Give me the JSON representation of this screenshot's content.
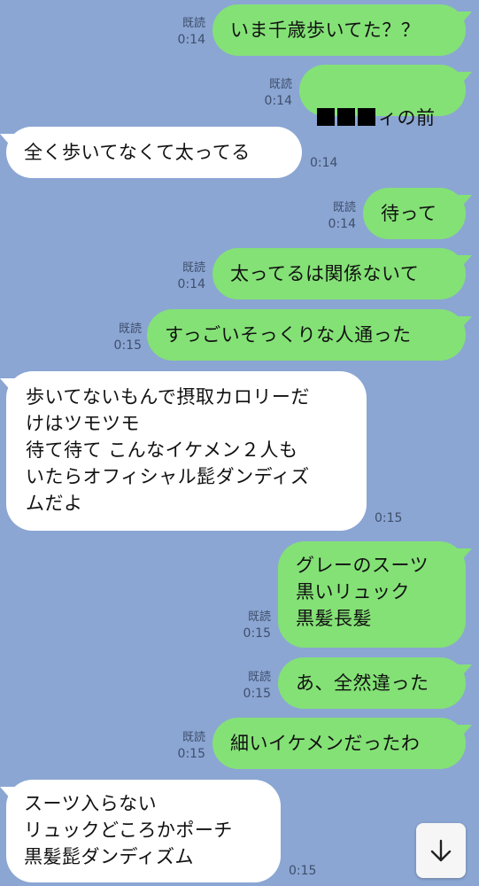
{
  "messages": [
    {
      "direction": "out",
      "text": "いま千歳歩いてた？？",
      "read": "既読",
      "time": "0:14"
    },
    {
      "direction": "out",
      "text": "ィの前",
      "redacted_blocks": 3,
      "read": "既読",
      "time": "0:14"
    },
    {
      "direction": "in",
      "text": "全く歩いてなくて太ってる",
      "time": "0:14"
    },
    {
      "direction": "out",
      "text": "待って",
      "read": "既読",
      "time": "0:14"
    },
    {
      "direction": "out",
      "text": "太ってるは関係ないて",
      "read": "既読",
      "time": "0:14"
    },
    {
      "direction": "out",
      "text": "すっごいそっくりな人通った",
      "read": "既読",
      "time": "0:15"
    },
    {
      "direction": "in",
      "text": "歩いてないもんで摂取カロリーだ\nけはツモツモ\n待て待て こんなイケメン２人も\nいたらオフィシャル髭ダンディズ\nムだよ",
      "time": "0:15"
    },
    {
      "direction": "out",
      "text": "グレーのスーツ\n黒いリュック\n黒髪長髪",
      "read": "既読",
      "time": "0:15"
    },
    {
      "direction": "out",
      "text": "あ、全然違った",
      "read": "既読",
      "time": "0:15"
    },
    {
      "direction": "out",
      "text": "細いイケメンだったわ",
      "read": "既読",
      "time": "0:15"
    },
    {
      "direction": "in",
      "text": "スーツ入らない\nリュックどころかポーチ\n黒髪髭ダンディズム",
      "time": "0:15"
    }
  ],
  "scroll_button": {
    "icon": "arrow-down-icon"
  },
  "colors": {
    "background": "#8ba6d3",
    "outgoing_bubble": "#84e176",
    "incoming_bubble": "#ffffff",
    "meta_text": "#3f4f6c"
  }
}
